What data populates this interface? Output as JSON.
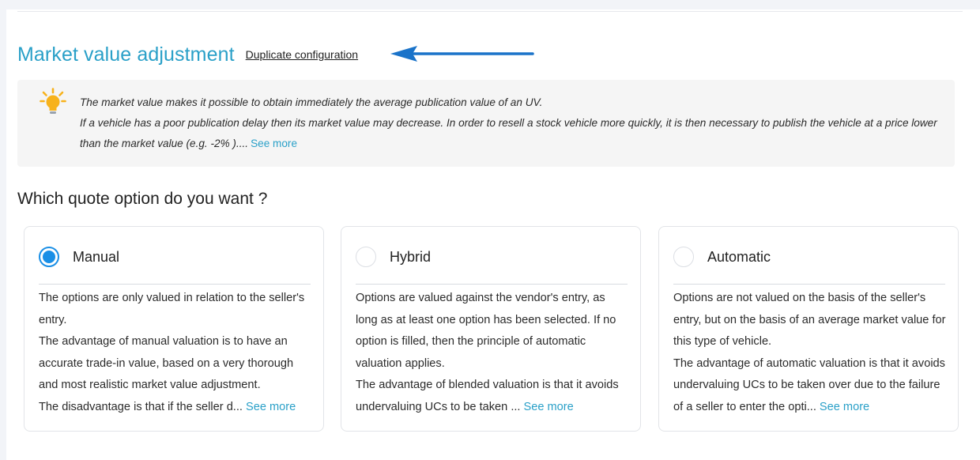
{
  "section": {
    "title": "Market value adjustment",
    "duplicate_link": "Duplicate configuration"
  },
  "info": {
    "icon": "lightbulb-icon",
    "line1": "The market value makes it possible to obtain immediately the average publication value of an UV.",
    "line2": "If a vehicle has a poor publication delay then its market value may decrease. In order to resell a stock vehicle  more quickly, it is then necessary to publish the vehicle at a price lower than the market value (e.g. -2% )....",
    "see_more": "See more"
  },
  "question": "Which quote option do you want ?",
  "options": [
    {
      "label": "Manual",
      "selected": true,
      "lines": [
        "The options are only valued in relation to the seller's entry.",
        "The advantage of manual valuation is to have an accurate trade-in value, based on a very thorough and most realistic market value adjustment.",
        "The disadvantage is that if the seller d..."
      ],
      "see_more": "See more"
    },
    {
      "label": "Hybrid",
      "selected": false,
      "lines": [
        "Options are valued against the vendor's entry, as long as at least one option has been selected. If no option is filled, then the principle of automatic valuation applies.",
        "The advantage of blended valuation is that it avoids undervaluing UCs to be taken ..."
      ],
      "see_more": "See more"
    },
    {
      "label": "Automatic",
      "selected": false,
      "lines": [
        "Options are not valued on the basis of the seller's entry, but on the basis of an average market value for this type of vehicle.",
        "The advantage of automatic valuation is that it avoids undervaluing UCs to be taken over due to the failure of a seller to enter the opti..."
      ],
      "see_more": "See more"
    }
  ],
  "colors": {
    "accent": "#2aa0c8",
    "radio_selected": "#1a8fe6",
    "arrow": "#1a73c9",
    "bulb": "#f7b21b"
  }
}
